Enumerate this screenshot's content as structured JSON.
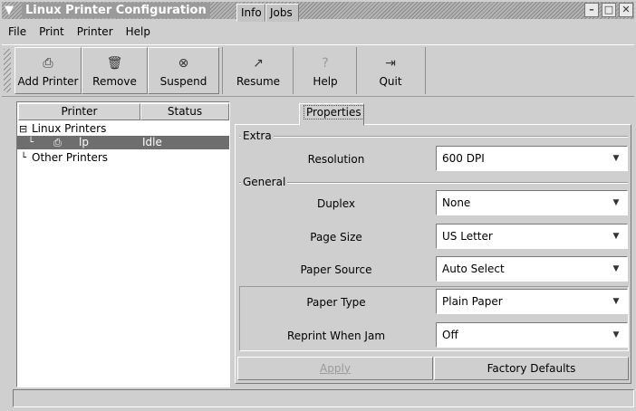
{
  "window": {
    "title": "Linux Printer Configuration"
  },
  "menubar": [
    "File",
    "Print",
    "Printer",
    "Help"
  ],
  "toolbar": {
    "add_printer": "Add Printer",
    "remove": "Remove",
    "suspend": "Suspend",
    "resume": "Resume",
    "help": "Help",
    "quit": "Quit"
  },
  "printer_list": {
    "col_printer": "Printer",
    "col_status": "Status",
    "group_linux": "Linux Printers",
    "printer_name": "lp",
    "printer_status": "Idle",
    "group_other": "Other Printers"
  },
  "tabs": [
    "Info",
    "Jobs",
    "Properties"
  ],
  "active_tab": "Properties",
  "groups": {
    "extra": "Extra",
    "general": "General"
  },
  "fields": {
    "resolution": {
      "label": "Resolution",
      "value": "600 DPI"
    },
    "duplex": {
      "label": "Duplex",
      "value": "None"
    },
    "page_size": {
      "label": "Page Size",
      "value": "US Letter"
    },
    "paper_source": {
      "label": "Paper Source",
      "value": "Auto Select"
    },
    "paper_type": {
      "label": "Paper Type",
      "value": "Plain Paper"
    },
    "reprint_when_jam": {
      "label": "Reprint When Jam",
      "value": "Off"
    }
  },
  "buttons": {
    "apply": "Apply",
    "factory_defaults": "Factory Defaults"
  },
  "icons": {
    "window_menu": "chevron-down-icon",
    "minimize": "minimize-icon",
    "maximize": "maximize-icon",
    "close": "close-icon"
  }
}
